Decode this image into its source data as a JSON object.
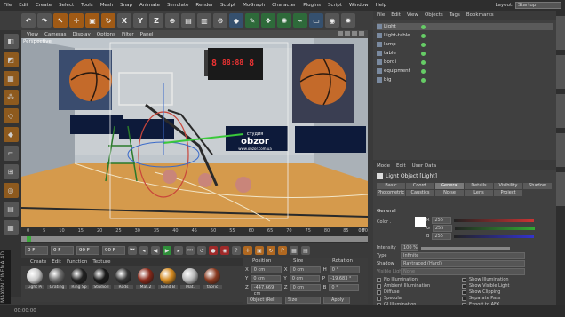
{
  "menubar": {
    "items": [
      "File",
      "Edit",
      "Create",
      "Select",
      "Tools",
      "Mesh",
      "Snap",
      "Animate",
      "Simulate",
      "Render",
      "Sculpt",
      "MoGraph",
      "Character",
      "Plugins",
      "Script",
      "Window",
      "Help"
    ],
    "layout_label": "Layout:",
    "layout_value": "Startup"
  },
  "toolbar": {
    "axis_buttons": [
      "X",
      "Y",
      "Z"
    ]
  },
  "viewport": {
    "menu": [
      "View",
      "Cameras",
      "Display",
      "Options",
      "Filter",
      "Panel"
    ],
    "label": "Perspective",
    "scoreboard_left": "8",
    "scoreboard_time": "88:88",
    "scoreboard_right": "8",
    "banner_brand": "obzor",
    "banner_sub": "студия",
    "banner_url": "www.obzor.com.ua"
  },
  "timeline": {
    "ticks": [
      "0",
      "5",
      "10",
      "15",
      "20",
      "25",
      "30",
      "35",
      "40",
      "45",
      "50",
      "55",
      "60",
      "65",
      "70",
      "75",
      "80",
      "85",
      "90"
    ],
    "end_label": "0 F"
  },
  "transport": {
    "start": "0 F",
    "current": "0 F",
    "end": "90 F",
    "end2": "90 F"
  },
  "materials": {
    "menu": [
      "Create",
      "Edit",
      "Function",
      "Texture"
    ],
    "items": [
      {
        "name": "Light Pi",
        "color": "#c9c9c9"
      },
      {
        "name": "Grating",
        "color": "#6a6a6a"
      },
      {
        "name": "Ring Sp",
        "color": "#222222"
      },
      {
        "name": "Studio I",
        "color": "#1a1a1a"
      },
      {
        "name": "Rods",
        "color": "#333333"
      },
      {
        "name": "Mat.2",
        "color": "#8a2a1a"
      },
      {
        "name": "Band B",
        "color": "#d48a20"
      },
      {
        "name": "Mat.",
        "color": "#b8b8b8"
      },
      {
        "name": "fabric",
        "color": "#8a3a20"
      }
    ]
  },
  "coords": {
    "headers": [
      "Position",
      "Size",
      "Rotation"
    ],
    "rows": [
      {
        "axis": "X",
        "pos": "0 cm",
        "size": "0 cm",
        "rot_axis": "H",
        "rot": "0 °"
      },
      {
        "axis": "Y",
        "pos": "0 cm",
        "size": "0 cm",
        "rot_axis": "P",
        "rot": "-19.683 °"
      },
      {
        "axis": "Z",
        "pos": "-447.669 cm",
        "size": "0 cm",
        "rot_axis": "B",
        "rot": "0 °"
      }
    ],
    "mode": "Object (Rel)",
    "size_mode": "Size",
    "apply": "Apply"
  },
  "objects": {
    "menu": [
      "File",
      "Edit",
      "View",
      "Objects",
      "Tags",
      "Bookmarks"
    ],
    "items": [
      {
        "name": "Light",
        "selected": true
      },
      {
        "name": "Light-table",
        "selected": false
      },
      {
        "name": "lamp",
        "selected": false
      },
      {
        "name": "table",
        "selected": false
      },
      {
        "name": "bordi",
        "selected": false
      },
      {
        "name": "equipment",
        "selected": false
      },
      {
        "name": "big",
        "selected": false
      }
    ]
  },
  "attributes": {
    "menu": [
      "Mode",
      "Edit",
      "User Data"
    ],
    "title": "Light Object [Light]",
    "tabs": [
      "Basic",
      "Coord.",
      "General",
      "Details",
      "Visibility",
      "Shadow",
      "Photometric",
      "Caustics",
      "Noise",
      "Lens",
      "Project"
    ],
    "active_tab": "General",
    "section": "General",
    "color_label": "Color .",
    "rgb": [
      {
        "ch": "R",
        "val": "255"
      },
      {
        "ch": "G",
        "val": "255"
      },
      {
        "ch": "B",
        "val": "255"
      }
    ],
    "intensity_label": "Intensity",
    "intensity_value": "100 %",
    "type_label": "Type",
    "type_value": "Infinite",
    "shadow_label": "Shadow",
    "shadow_value": "Raytraced (Hard)",
    "visible_light_label": "Visible Light",
    "visible_light_value": "None",
    "options_left": [
      "No Illumination",
      "Ambient Illumination",
      "Diffuse",
      "Specular",
      "GI Illumination"
    ],
    "options_right": [
      "Show Illumination",
      "Show Visible Light",
      "Show Clipping",
      "Separate Pass",
      "Export to AFX"
    ]
  },
  "status": {
    "time": "00:00:00"
  }
}
